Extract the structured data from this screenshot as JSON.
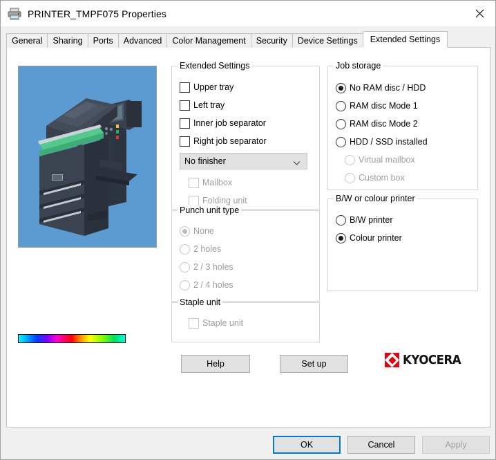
{
  "window": {
    "title": "PRINTER_TMPF075 Properties",
    "icon": "printer-icon",
    "close_icon": "close-icon"
  },
  "tabs": [
    {
      "label": "General",
      "selected": false
    },
    {
      "label": "Sharing",
      "selected": false
    },
    {
      "label": "Ports",
      "selected": false
    },
    {
      "label": "Advanced",
      "selected": false
    },
    {
      "label": "Color Management",
      "selected": false
    },
    {
      "label": "Security",
      "selected": false
    },
    {
      "label": "Device Settings",
      "selected": false
    },
    {
      "label": "Extended Settings",
      "selected": true
    }
  ],
  "preview": {
    "alt": "printer-device-illustration",
    "background_color": "#5b9bd1",
    "gradient_bar": "colour-spectrum-bar"
  },
  "extended_settings": {
    "legend": "Extended Settings",
    "checkboxes": [
      {
        "label": "Upper tray",
        "checked": false,
        "enabled": true
      },
      {
        "label": "Left tray",
        "checked": false,
        "enabled": true
      },
      {
        "label": "Inner job separator",
        "checked": false,
        "enabled": true
      },
      {
        "label": "Right job separator",
        "checked": false,
        "enabled": true
      }
    ],
    "finisher": {
      "name": "finisher-dropdown",
      "value": "No finisher",
      "options": [
        "No finisher"
      ]
    },
    "sub_checkboxes": [
      {
        "label": "Mailbox",
        "checked": false,
        "enabled": false
      },
      {
        "label": "Folding unit",
        "checked": false,
        "enabled": false
      }
    ]
  },
  "punch_unit": {
    "legend": "Punch unit type",
    "options": [
      {
        "label": "None",
        "selected": true,
        "enabled": false
      },
      {
        "label": "2 holes",
        "selected": false,
        "enabled": false
      },
      {
        "label": "2 / 3 holes",
        "selected": false,
        "enabled": false
      },
      {
        "label": "2 / 4 holes",
        "selected": false,
        "enabled": false
      }
    ]
  },
  "staple_unit": {
    "legend": "Staple unit",
    "checkboxes": [
      {
        "label": "Staple unit",
        "checked": false,
        "enabled": false
      }
    ]
  },
  "job_storage": {
    "legend": "Job storage",
    "options": [
      {
        "label": "No RAM disc / HDD",
        "selected": true,
        "enabled": true
      },
      {
        "label": "RAM disc Mode 1",
        "selected": false,
        "enabled": true
      },
      {
        "label": "RAM disc Mode 2",
        "selected": false,
        "enabled": true
      },
      {
        "label": "HDD / SSD installed",
        "selected": false,
        "enabled": true
      },
      {
        "label": "Virtual mailbox",
        "selected": false,
        "enabled": false
      },
      {
        "label": "Custom box",
        "selected": false,
        "enabled": false
      }
    ]
  },
  "printer_type": {
    "legend": "B/W or colour printer",
    "options": [
      {
        "label": "B/W printer",
        "selected": false,
        "enabled": true
      },
      {
        "label": "Colour printer",
        "selected": true,
        "enabled": true
      }
    ]
  },
  "panel_buttons": {
    "help": "Help",
    "setup": "Set up"
  },
  "branding": {
    "name": "KYOCERA",
    "mark_color": "#df0613"
  },
  "footer_buttons": {
    "ok": "OK",
    "cancel": "Cancel",
    "apply": "Apply",
    "accent_color": "#0078d7"
  }
}
